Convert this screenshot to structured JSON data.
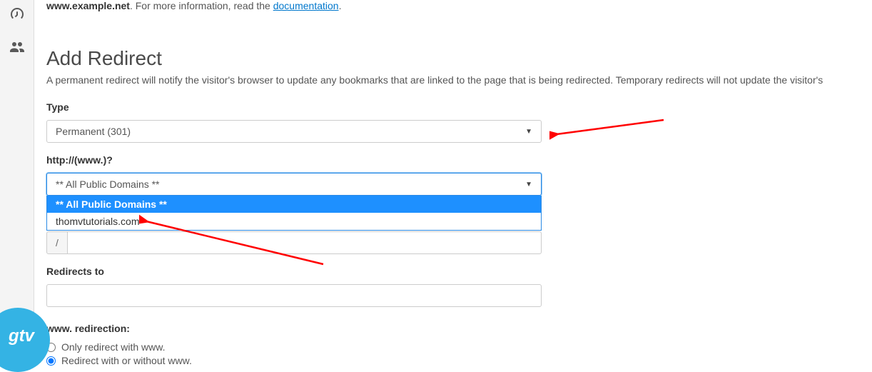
{
  "intro": {
    "bold_prefix": "www.example.net",
    "rest": ". For more information, read the ",
    "link_text": "documentation",
    "suffix": "."
  },
  "title": "Add Redirect",
  "description": "A permanent redirect will notify the visitor's browser to update any bookmarks that are linked to the page that is being redirected. Temporary redirects will not update the visitor's",
  "type": {
    "label": "Type",
    "selected": "Permanent (301)"
  },
  "domain": {
    "label": "http://(www.)?",
    "selected": "** All Public Domains **",
    "options": [
      "** All Public Domains **",
      "thomvtutorials.com"
    ]
  },
  "path": {
    "prefix": "/",
    "value": ""
  },
  "redirects_to": {
    "label": "Redirects to",
    "value": ""
  },
  "www_redirection": {
    "label": "www. redirection:",
    "options": [
      "Only redirect with www.",
      "Redirect with or without www."
    ],
    "selected_index": 1
  },
  "logo": "gtv"
}
